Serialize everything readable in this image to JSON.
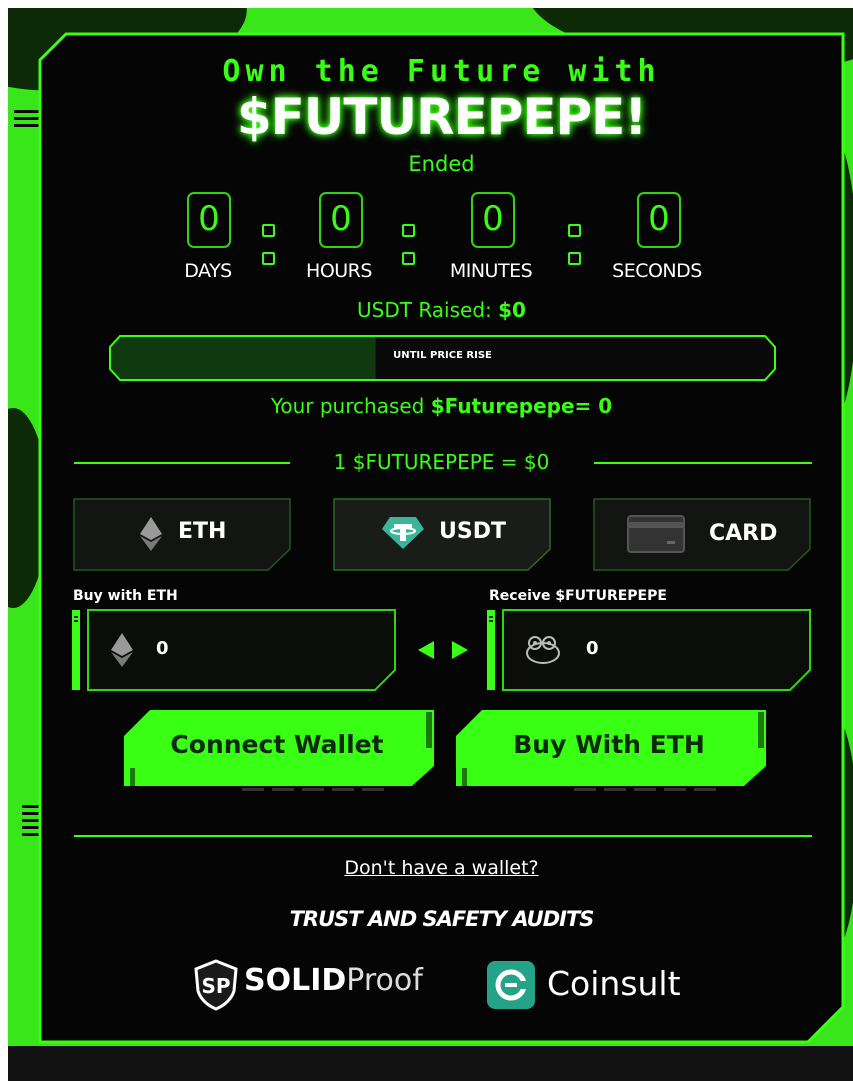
{
  "hero": {
    "line1": "Own the Future with",
    "line2": "$FUTUREPEPE!",
    "status": "Ended"
  },
  "countdown": {
    "days": {
      "value": "0",
      "label": "DAYS"
    },
    "hours": {
      "value": "0",
      "label": "HOURS"
    },
    "minutes": {
      "value": "0",
      "label": "MINUTES"
    },
    "seconds": {
      "value": "0",
      "label": "SECONDS"
    }
  },
  "raised": {
    "label": "USDT Raised: ",
    "amount": "$0"
  },
  "progress": {
    "label": "UNTIL PRICE RISE",
    "fraction": 0.4
  },
  "purchased": {
    "label": "Your purchased ",
    "amount": "$Futurepepe= 0"
  },
  "price_line": "1 $FUTUREPEPE = $0",
  "tabs": [
    {
      "label": "ETH",
      "icon": "ethereum-icon"
    },
    {
      "label": "USDT",
      "icon": "tether-icon"
    },
    {
      "label": "CARD",
      "icon": "credit-card-icon"
    }
  ],
  "pay_field": {
    "label": "Buy with ETH",
    "value": "0",
    "icon": "ethereum-icon"
  },
  "receive_field": {
    "label": "Receive $FUTUREPEPE",
    "value": "0",
    "icon": "frog-icon"
  },
  "buttons": {
    "connect": "Connect Wallet",
    "buy": "Buy With ETH"
  },
  "no_wallet": "Don't have a wallet?",
  "audits": {
    "title": "TRUST AND SAFETY AUDITS",
    "solid_bold": "SOLID",
    "solid_light": "Proof",
    "coinsult": "Coinsult"
  },
  "colors": {
    "accent": "#39ff14",
    "panel": "#050505",
    "dark_green": "#0b2a0b"
  }
}
